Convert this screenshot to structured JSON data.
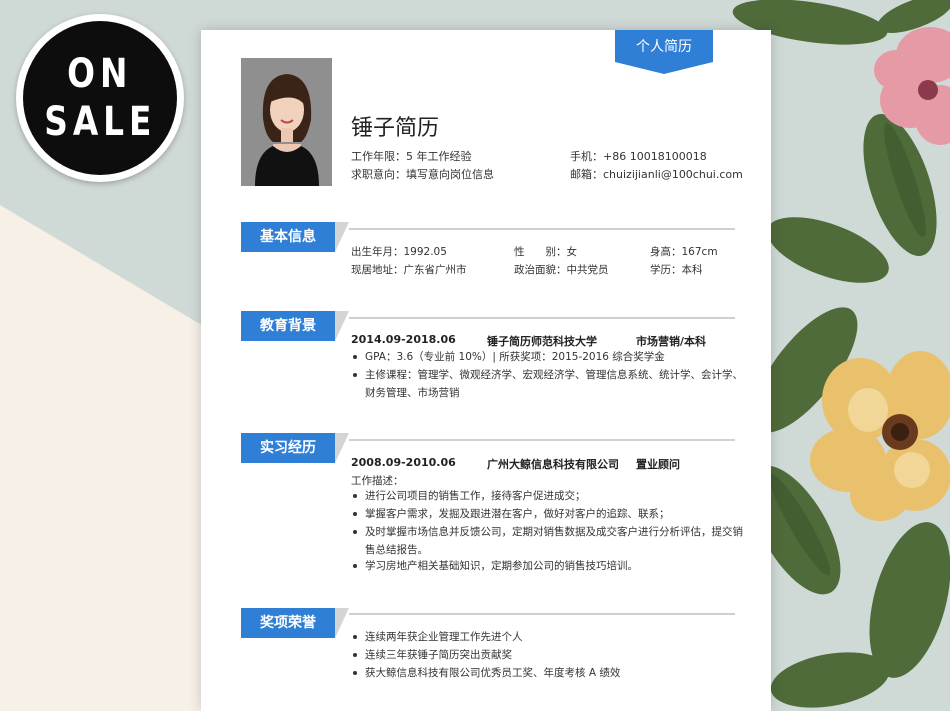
{
  "badge": {
    "line1": "ON",
    "line2": "SALE"
  },
  "resume": {
    "tag": "个人简历",
    "name": "锤子简历",
    "work_years": "工作年限：5 年工作经验",
    "job_intent": "求职意向：填写意向岗位信息",
    "phone": "手机：+86 10018100018",
    "email": "邮箱：chuizijianli@100chui.com"
  },
  "basic": {
    "title": "基本信息",
    "birth": "出生年月：1992.05",
    "gender": "性　　别：女",
    "height": "身高：167cm",
    "address": "现居地址：广东省广州市",
    "politics": "政治面貌：中共党员",
    "degree": "学历：本科"
  },
  "education": {
    "title": "教育背景",
    "period": "2014.09-2018.06",
    "school": "锤子简历师范科技大学",
    "major": "市场营销/本科",
    "bullets": [
      "GPA：3.6（专业前 10%）| 所获奖项：2015-2016 综合奖学金",
      "主修课程：管理学、微观经济学、宏观经济学、管理信息系统、统计学、会计学、",
      "财务管理、市场营销"
    ]
  },
  "internship": {
    "title": "实习经历",
    "period": "2008.09-2010.06",
    "company": "广州大鲸信息科技有限公司",
    "position": "置业顾问",
    "desc_label": "工作描述：",
    "bullets": [
      "进行公司项目的销售工作，接待客户促进成交；",
      "掌握客户需求，发掘及跟进潜在客户，做好对客户的追踪、联系；",
      "及时掌握市场信息并反馈公司，定期对销售数据及成交客户进行分析评估，提交销",
      "售总结报告。",
      "学习房地产相关基础知识，定期参加公司的销售技巧培训。"
    ]
  },
  "awards": {
    "title": "奖项荣誉",
    "bullets": [
      "连续两年获企业管理工作先进个人",
      "连续三年获锤子简历突出贡献奖",
      "获大鲸信息科技有限公司优秀员工奖、年度考核 A 绩效"
    ]
  },
  "colors": {
    "accent": "#2f7fd6",
    "badge": "#0d0d0d",
    "background": "#cfd9d6",
    "cream": "#f6f0e7"
  }
}
